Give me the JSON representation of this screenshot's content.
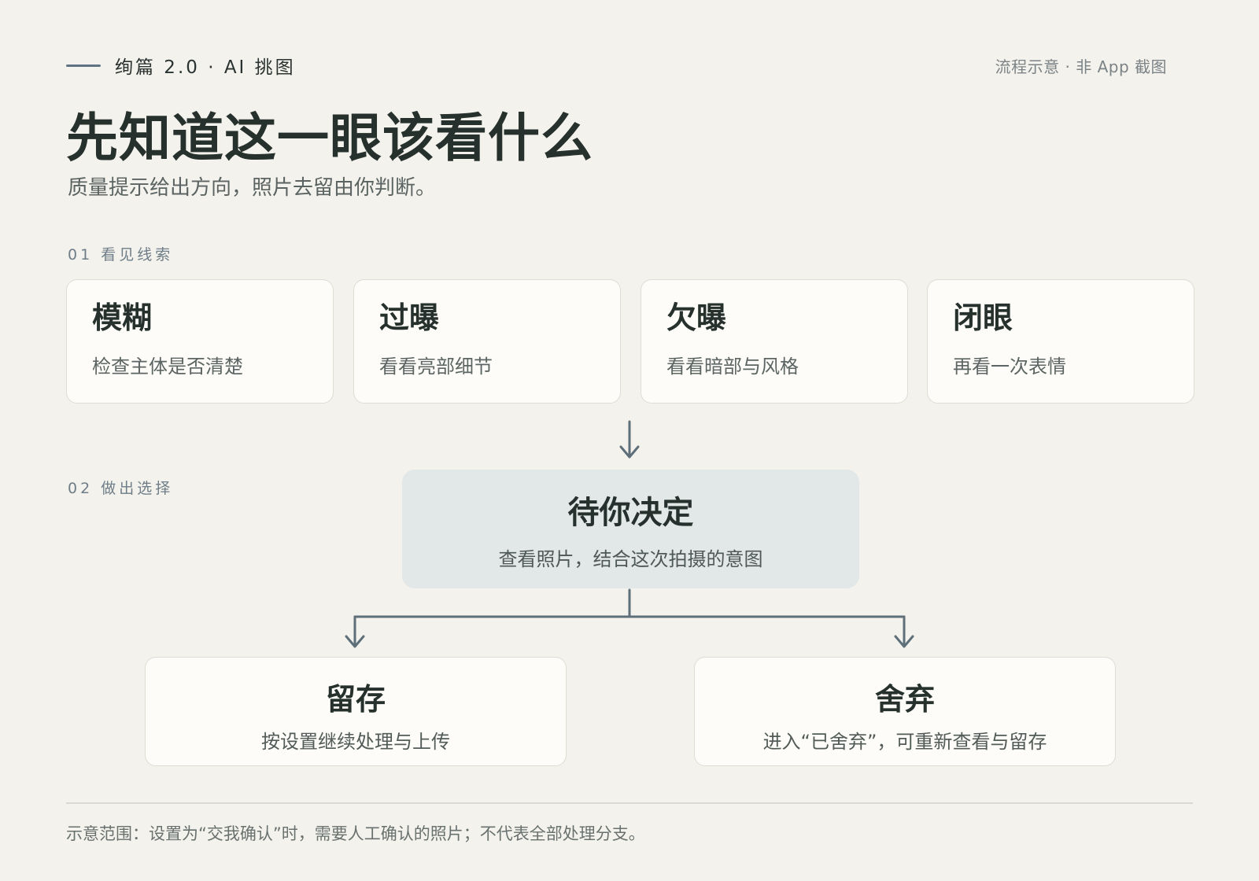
{
  "header": {
    "brand": "绚篇 2.0 · AI 挑图",
    "note": "流程示意 · 非 App 截图",
    "title": "先知道这一眼该看什么",
    "subtitle": "质量提示给出方向，照片去留由你判断。"
  },
  "section1": {
    "label": "01 看见线索",
    "cards": [
      {
        "title": "模糊",
        "desc": "检查主体是否清楚"
      },
      {
        "title": "过曝",
        "desc": "看看亮部细节"
      },
      {
        "title": "欠曝",
        "desc": "看看暗部与风格"
      },
      {
        "title": "闭眼",
        "desc": "再看一次表情"
      }
    ]
  },
  "section2": {
    "label": "02 做出选择",
    "decision": {
      "title": "待你决定",
      "desc": "查看照片，结合这次拍摄的意图"
    },
    "outcomes": [
      {
        "title": "留存",
        "desc": "按设置继续处理与上传"
      },
      {
        "title": "舍弃",
        "desc": "进入“已舍弃”，可重新查看与留存"
      }
    ]
  },
  "footer": {
    "note": "示意范围：设置为“交我确认”时，需要人工确认的照片；不代表全部处理分支。"
  },
  "colors": {
    "background": "#f4f2ed",
    "card": "#fdfcf8",
    "decision": "#e2e7e7",
    "accent": "#5e7482",
    "text": "#26302d"
  }
}
